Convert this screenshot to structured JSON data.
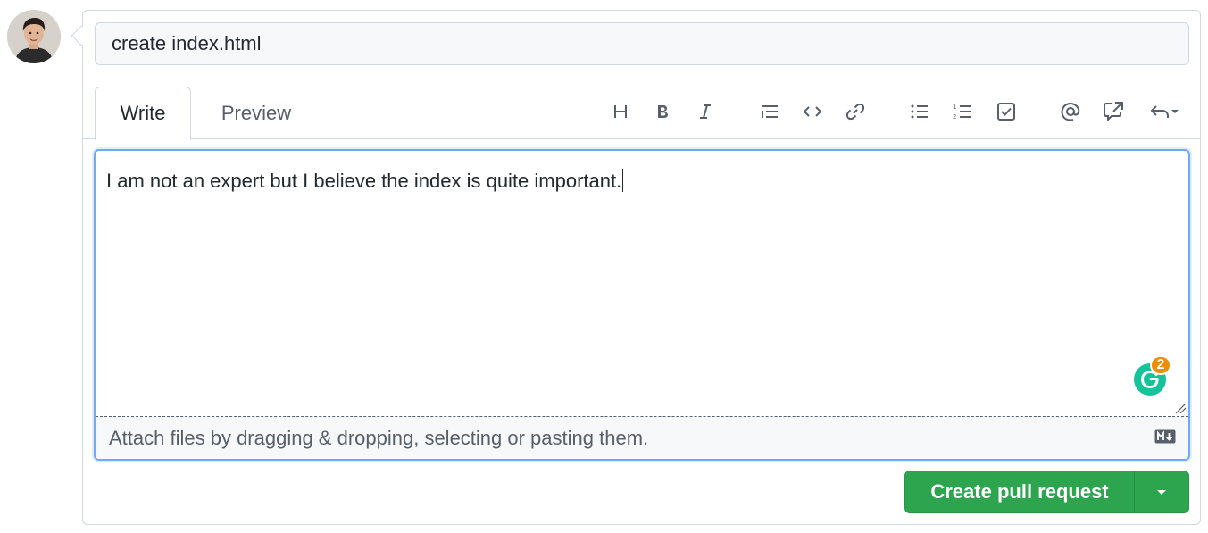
{
  "avatar": {
    "alt": "user avatar"
  },
  "pr_form": {
    "title_value": "create index.html",
    "tabs": [
      {
        "label": "Write",
        "active": true
      },
      {
        "label": "Preview",
        "active": false
      }
    ],
    "toolbar": [
      {
        "name": "heading-icon"
      },
      {
        "name": "bold-icon"
      },
      {
        "name": "italic-icon"
      },
      {
        "name": "quote-icon"
      },
      {
        "name": "code-icon"
      },
      {
        "name": "link-icon"
      },
      {
        "name": "unordered-list-icon"
      },
      {
        "name": "ordered-list-icon"
      },
      {
        "name": "task-list-icon"
      },
      {
        "name": "mention-icon"
      },
      {
        "name": "cross-reference-icon"
      },
      {
        "name": "saved-replies-icon"
      }
    ],
    "body_text": "I am not an expert but I believe the index is quite important.",
    "attach_text": "Attach files by dragging & dropping, selecting or pasting them.",
    "grammarly_count": "2",
    "submit_label": "Create pull request"
  },
  "colors": {
    "primary_button": "#2da44e",
    "focus_border": "#6ea8ff",
    "grammarly": "#15c39a",
    "grammarly_badge": "#f08c00"
  }
}
